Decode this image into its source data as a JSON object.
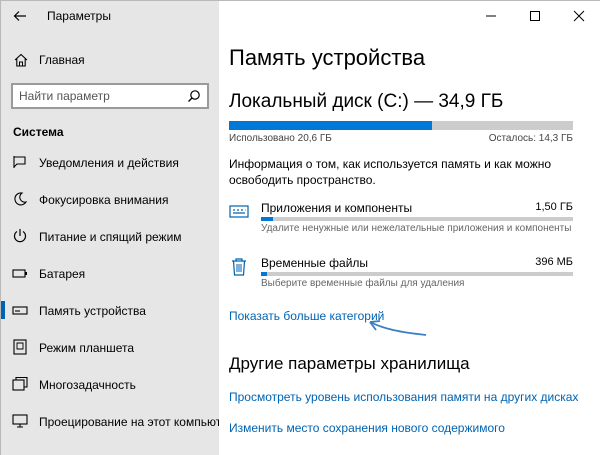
{
  "window": {
    "title": "Параметры"
  },
  "sidebar": {
    "home_label": "Главная",
    "search_placeholder": "Найти параметр",
    "section_header": "Система",
    "items": [
      {
        "label": "Уведомления и действия",
        "icon": "notifications-icon"
      },
      {
        "label": "Фокусировка внимания",
        "icon": "moon-icon"
      },
      {
        "label": "Питание и спящий режим",
        "icon": "power-icon"
      },
      {
        "label": "Батарея",
        "icon": "battery-icon"
      },
      {
        "label": "Память устройства",
        "icon": "storage-icon",
        "active": true
      },
      {
        "label": "Режим планшета",
        "icon": "tablet-icon"
      },
      {
        "label": "Многозадачность",
        "icon": "multitasking-icon"
      },
      {
        "label": "Проецирование на этот компьютер",
        "icon": "projection-icon"
      }
    ]
  },
  "main": {
    "page_title": "Память устройства",
    "disk_title": "Локальный диск (C:) — 34,9 ГБ",
    "usage": {
      "used_label": "Использовано 20,6 ГБ",
      "free_label": "Осталось: 14,3 ГБ",
      "used_fraction": 0.59
    },
    "info_text": "Информация о том, как используется память и как можно освободить пространство.",
    "categories": [
      {
        "name": "Приложения и компоненты",
        "size": "1,50 ГБ",
        "description": "Удалите ненужные или нежелательные приложения и компоненты",
        "icon": "apps-icon",
        "fraction": 0.04
      },
      {
        "name": "Временные файлы",
        "size": "396 МБ",
        "description": "Выберите временные файлы для удаления",
        "icon": "trash-icon",
        "fraction": 0.02
      }
    ],
    "show_more_link": "Показать больше категорий",
    "other_header": "Другие параметры хранилища",
    "links": [
      "Просмотреть уровень использования памяти на других дисках",
      "Изменить место сохранения нового содержимого"
    ]
  },
  "colors": {
    "accent": "#0078d7",
    "link": "#0063b1",
    "sidebar_bg": "#e6e6e6",
    "annotation_arrow": "#3a7fc4"
  }
}
